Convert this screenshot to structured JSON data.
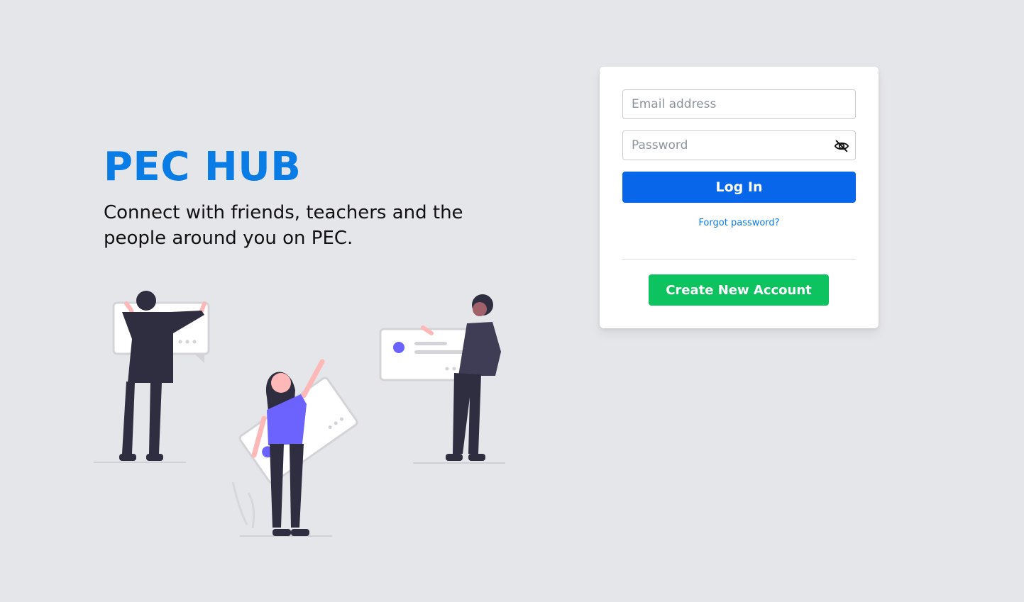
{
  "hero": {
    "brand": "PEC HUB",
    "tagline": "Connect with friends, teachers and the people around you on PEC."
  },
  "login": {
    "email_placeholder": "Email address",
    "password_placeholder": "Password",
    "password_toggle_icon": "eye-slash-icon",
    "login_label": "Log In",
    "forgot_label": "Forgot password?",
    "create_label": "Create New Account"
  },
  "colors": {
    "background": "#e5e6ea",
    "brand": "#0a7ce6",
    "login_button": "#0866ea",
    "create_button": "#0dc35f",
    "illustration_accent": "#6c63ff",
    "illustration_dark": "#2f2e41",
    "illustration_skin": "#ffb8b8"
  }
}
